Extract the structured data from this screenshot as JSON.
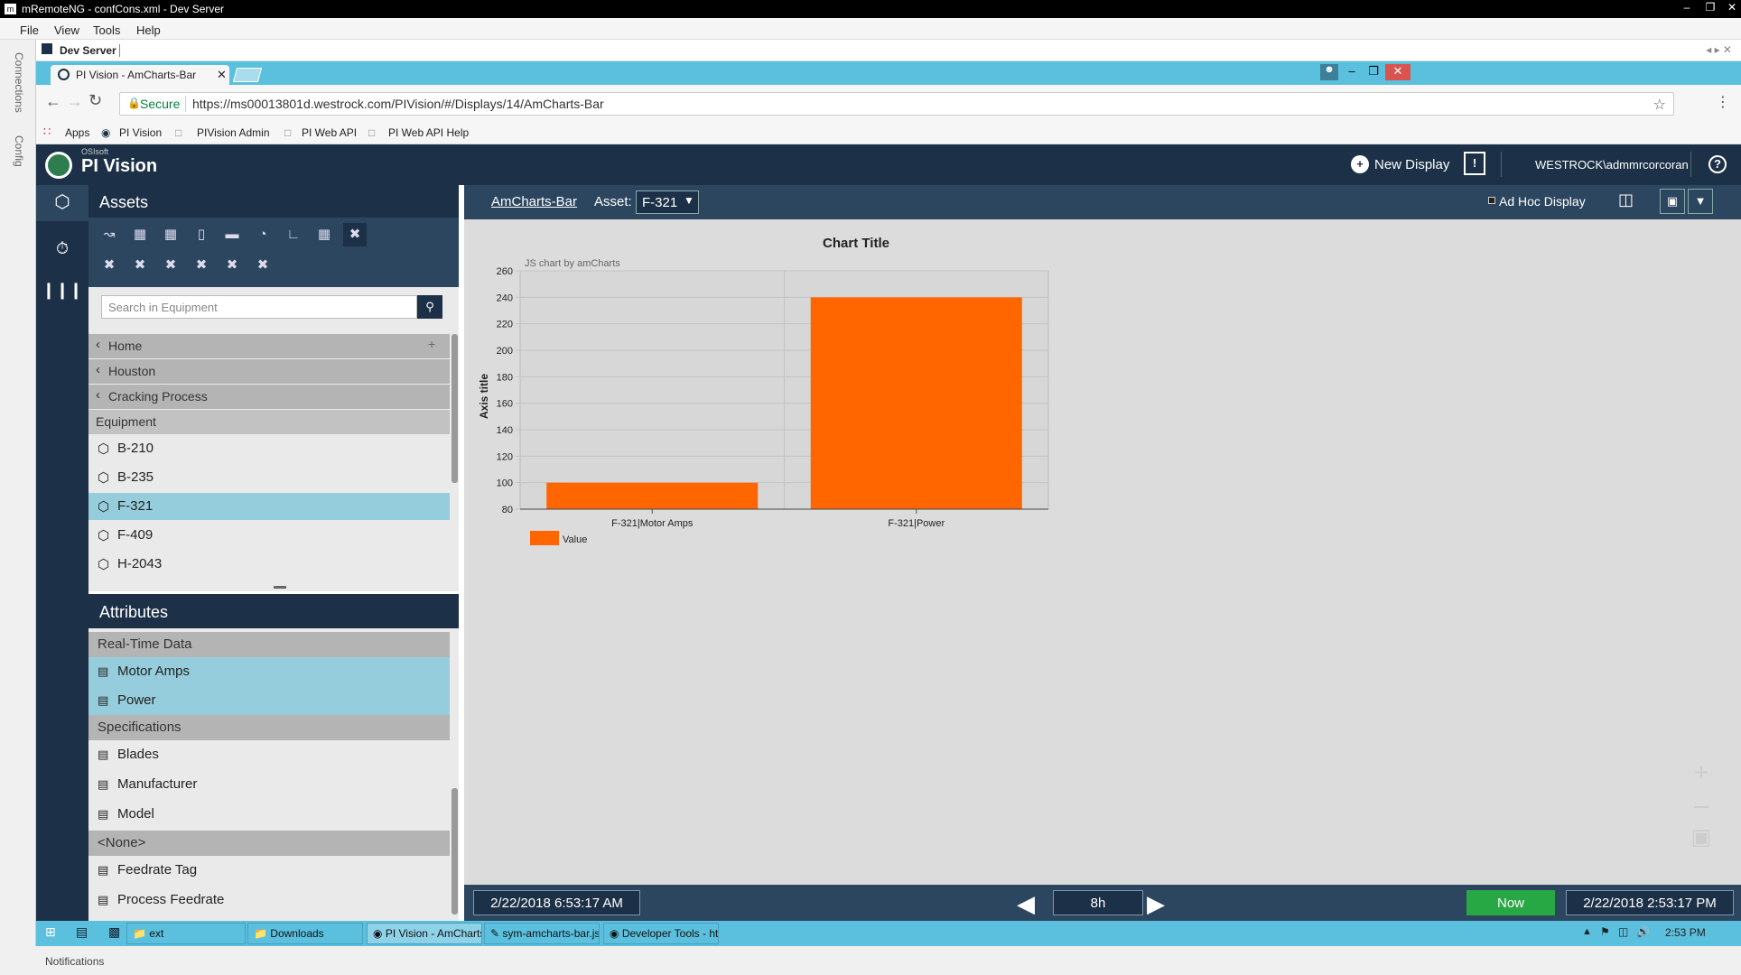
{
  "window": {
    "title": "mRemoteNG - confCons.xml - Dev Server"
  },
  "menu": [
    "File",
    "View",
    "Tools",
    "Help"
  ],
  "side_tabs": [
    "Connections",
    "Config"
  ],
  "connection_tab": "Dev Server",
  "browser": {
    "tab_title": "PI Vision - AmCharts-Bar",
    "secure_label": "Secure",
    "url": "https://ms00013801d.westrock.com/PIVision/#/Displays/14/AmCharts-Bar",
    "bookmarks": [
      "Apps",
      "PI Vision",
      "PIVision Admin",
      "PI Web API",
      "PI Web API Help"
    ]
  },
  "pivision": {
    "brand_small": "OSIsoft",
    "brand": "PI Vision",
    "new_display": "New Display",
    "user": "WESTROCK\\admmrcorcoran",
    "help": "?"
  },
  "assets": {
    "title": "Assets",
    "search_placeholder": "Search in Equipment",
    "breadcrumbs": [
      "Home",
      "Houston",
      "Cracking Process"
    ],
    "group": "Equipment",
    "items": [
      "B-210",
      "B-235",
      "F-321",
      "F-409",
      "H-2043"
    ],
    "selected": "F-321"
  },
  "attributes": {
    "title": "Attributes",
    "groups": [
      {
        "name": "Real-Time Data",
        "items": [
          "Motor Amps",
          "Power"
        ]
      },
      {
        "name": "Specifications",
        "items": [
          "Blades",
          "Manufacturer",
          "Model"
        ]
      },
      {
        "name": "<None>",
        "items": [
          "Feedrate Tag",
          "Process Feedrate"
        ]
      }
    ]
  },
  "display": {
    "name": "AmCharts-Bar",
    "asset_label": "Asset:",
    "asset_value": "F-321",
    "adhoc": "Ad Hoc Display"
  },
  "chart_data": {
    "type": "bar",
    "title": "Chart Title",
    "credit": "JS chart by amCharts",
    "ylabel": "Axis title",
    "xlabel": "",
    "categories": [
      "F-321|Motor Amps",
      "F-321|Power"
    ],
    "series": [
      {
        "name": "Value",
        "values": [
          100,
          240
        ]
      }
    ],
    "ylim": [
      80,
      260
    ],
    "yticks": [
      80,
      100,
      120,
      140,
      160,
      180,
      200,
      220,
      240,
      260
    ],
    "color": "#ff6600",
    "grid": true,
    "legend": "bottom-left"
  },
  "timebar": {
    "start": "2/22/2018 6:53:17 AM",
    "duration": "8h",
    "now": "Now",
    "end": "2/22/2018 2:53:17 PM"
  },
  "taskbar": {
    "items": [
      "ext",
      "Downloads",
      "PI Vision - AmCharts...",
      "sym-amcharts-bar.js...",
      "Developer Tools - htt..."
    ],
    "clock": "2:53 PM"
  },
  "status": {
    "notifications": "Notifications"
  },
  "colors": {
    "accent": "#5bc0de",
    "dark_navy": "#1c3147",
    "selection": "#96cddc",
    "bar": "#ff6600",
    "now_button": "#28a745"
  }
}
